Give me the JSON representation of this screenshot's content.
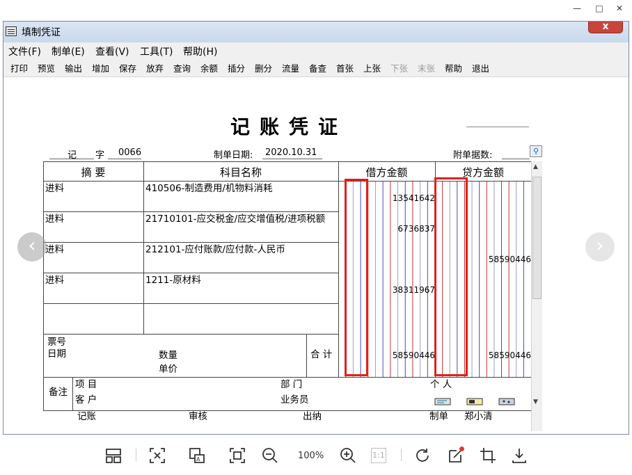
{
  "window": {
    "title": "填制凭证",
    "close_label": "x",
    "controls": {
      "minimize": "—",
      "maximize": "□",
      "close": "✕"
    }
  },
  "menu": [
    "文件(F)",
    "制单(E)",
    "查看(V)",
    "工具(T)",
    "帮助(H)"
  ],
  "toolbar": [
    {
      "label": "打印",
      "enabled": true
    },
    {
      "label": "预览",
      "enabled": true
    },
    {
      "label": "输出",
      "enabled": true
    },
    {
      "label": "增加",
      "enabled": true
    },
    {
      "label": "保存",
      "enabled": true
    },
    {
      "label": "放弃",
      "enabled": true
    },
    {
      "label": "查询",
      "enabled": true
    },
    {
      "label": "余额",
      "enabled": true
    },
    {
      "label": "插分",
      "enabled": true
    },
    {
      "label": "删分",
      "enabled": true
    },
    {
      "label": "流量",
      "enabled": true
    },
    {
      "label": "备查",
      "enabled": true
    },
    {
      "label": "首张",
      "enabled": true
    },
    {
      "label": "上张",
      "enabled": true
    },
    {
      "label": "下张",
      "enabled": false
    },
    {
      "label": "末张",
      "enabled": false
    },
    {
      "label": "帮助",
      "enabled": true
    },
    {
      "label": "退出",
      "enabled": true
    }
  ],
  "voucher": {
    "title": "记账凭证",
    "type": "记",
    "zi_label": "字",
    "number": "0066",
    "date_label": "制单日期:",
    "date": "2020.10.31",
    "attach_label": "附单据数:",
    "headers": {
      "summary": "摘 要",
      "account": "科目名称",
      "debit": "借方金额",
      "credit": "贷方金额"
    },
    "rows": [
      {
        "summary": "进料",
        "account": "410506-制造费用/机物料消耗",
        "debit": "13541642",
        "credit": ""
      },
      {
        "summary": "进料",
        "account": "21710101-应交税金/应交增值税/进项税额",
        "debit": "6736837",
        "credit": ""
      },
      {
        "summary": "进料",
        "account": "212101-应付账款/应付款-人民币",
        "debit": "",
        "credit": "58590446"
      },
      {
        "summary": "进料",
        "account": "1211-原材料",
        "debit": "38311967",
        "credit": ""
      },
      {
        "summary": "",
        "account": "",
        "debit": "",
        "credit": ""
      }
    ],
    "footer": {
      "ticket_label": "票号",
      "date_label": "日期",
      "qty_label": "数量",
      "price_label": "单价",
      "total_label": "合 计",
      "total_debit": "58590446",
      "total_credit": "58590446"
    },
    "remarks": {
      "label": "备注",
      "project": "项  目",
      "dept": "部  门",
      "person": "个  人",
      "customer": "客  户",
      "salesman": "业务员"
    },
    "signatures": {
      "bookkeeper": "记账",
      "reviewer": "审核",
      "cashier": "出纳",
      "preparer": "制单",
      "preparer_name": "郑小清"
    }
  },
  "viewer": {
    "zoom": "100%",
    "ratio_label": "1:1",
    "icons": [
      "layout-icon",
      "fit-screen-icon",
      "ocr-icon",
      "fullscreen-icon",
      "zoom-out-icon",
      "zoom-in-icon",
      "actual-size-icon",
      "rotate-icon",
      "edit-icon",
      "crop-icon",
      "download-icon"
    ]
  }
}
